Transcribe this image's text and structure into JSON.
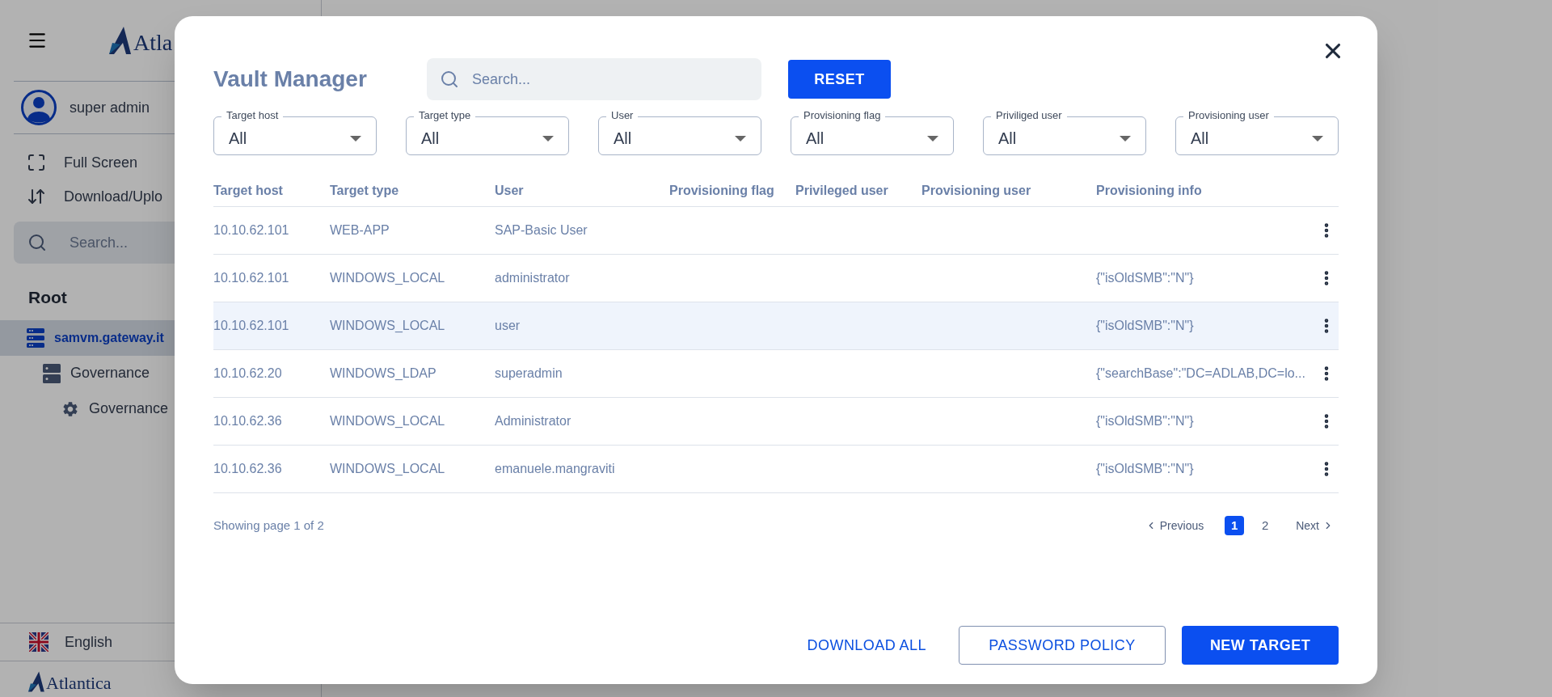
{
  "sidebar": {
    "logo": "Atla",
    "user": "super admin",
    "menu": [
      {
        "kind": "fullscreen",
        "label": "Full Screen"
      },
      {
        "kind": "transfer",
        "label": "Download/Uplo"
      }
    ],
    "search": {
      "placeholder": "Search..."
    },
    "tree_title": "Root",
    "tree": [
      {
        "kind": "server",
        "label": "samvm.gateway.it",
        "selected": true,
        "children": [
          {
            "kind": "group",
            "label": "Governance",
            "selected": false,
            "children": [
              {
                "kind": "gear",
                "label": "Governance",
                "selected": false
              }
            ]
          }
        ]
      }
    ],
    "language": "English",
    "footer_logo": "Atlantica"
  },
  "dialog": {
    "title": "Vault Manager",
    "search": {
      "placeholder": "Search..."
    },
    "reset": "RESET",
    "filters": [
      {
        "label": "Target host",
        "value": "All"
      },
      {
        "label": "Target type",
        "value": "All"
      },
      {
        "label": "User",
        "value": "All"
      },
      {
        "label": "Provisioning flag",
        "value": "All"
      },
      {
        "label": "Priviliged user",
        "value": "All"
      },
      {
        "label": "Provisioning user",
        "value": "All"
      }
    ],
    "table": {
      "columns": [
        "Target host",
        "Target type",
        "User",
        "Provisioning flag",
        "Privileged user",
        "Provisioning user",
        "Provisioning info"
      ],
      "rows": [
        {
          "cells": [
            "10.10.62.101",
            "WEB-APP",
            "SAP-Basic User",
            "",
            "",
            "",
            ""
          ],
          "selected": false
        },
        {
          "cells": [
            "10.10.62.101",
            "WINDOWS_LOCAL",
            "administrator",
            "",
            "",
            "",
            "{\"isOldSMB\":\"N\"}"
          ],
          "selected": false
        },
        {
          "cells": [
            "10.10.62.101",
            "WINDOWS_LOCAL",
            "user",
            "",
            "",
            "",
            "{\"isOldSMB\":\"N\"}"
          ],
          "selected": true
        },
        {
          "cells": [
            "10.10.62.20",
            "WINDOWS_LDAP",
            "superadmin",
            "",
            "",
            "",
            "{\"searchBase\":\"DC=ADLAB,DC=lo..."
          ],
          "selected": false
        },
        {
          "cells": [
            "10.10.62.36",
            "WINDOWS_LOCAL",
            "Administrator",
            "",
            "",
            "",
            "{\"isOldSMB\":\"N\"}"
          ],
          "selected": false
        },
        {
          "cells": [
            "10.10.62.36",
            "WINDOWS_LOCAL",
            "emanuele.mangraviti",
            "",
            "",
            "",
            "{\"isOldSMB\":\"N\"}"
          ],
          "selected": false
        }
      ]
    },
    "page_info": "Showing page 1 of 2",
    "pagination": {
      "previous": "Previous",
      "pages": [
        {
          "label": "1",
          "selected": true
        },
        {
          "label": "2",
          "selected": false
        }
      ],
      "next": "Next"
    },
    "buttons": [
      {
        "kind": "text",
        "label": "DOWNLOAD ALL"
      },
      {
        "kind": "outlined",
        "label": "PASSWORD POLICY"
      },
      {
        "kind": "filled",
        "label": "NEW TARGET"
      }
    ]
  }
}
